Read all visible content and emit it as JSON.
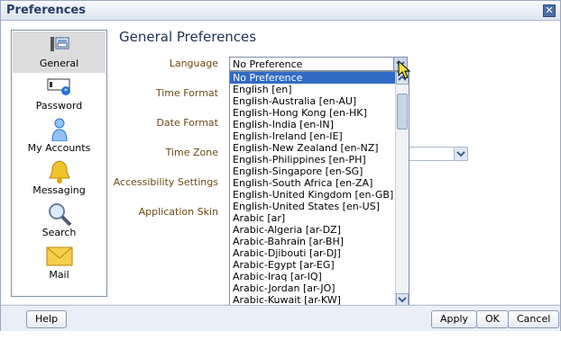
{
  "window": {
    "title": "Preferences"
  },
  "sidebar": {
    "items": [
      {
        "label": "General",
        "icon": "general-icon",
        "selected": true
      },
      {
        "label": "Password",
        "icon": "password-icon"
      },
      {
        "label": "My Accounts",
        "icon": "accounts-icon"
      },
      {
        "label": "Messaging",
        "icon": "bell-icon"
      },
      {
        "label": "Search",
        "icon": "magnifier-icon"
      },
      {
        "label": "Mail",
        "icon": "envelope-icon"
      }
    ]
  },
  "main": {
    "heading": "General Preferences",
    "fields": {
      "language": "Language",
      "time_format": "Time Format",
      "date_format": "Date Format",
      "time_zone": "Time Zone",
      "accessibility": "Accessibility Settings",
      "skin": "Application Skin"
    },
    "language_select": {
      "value": "No Preference",
      "options": [
        "No Preference",
        "English [en]",
        "English-Australia [en-AU]",
        "English-Hong Kong [en-HK]",
        "English-India [en-IN]",
        "English-Ireland [en-IE]",
        "English-New Zealand [en-NZ]",
        "English-Philippines [en-PH]",
        "English-Singapore [en-SG]",
        "English-South Africa [en-ZA]",
        "English-United Kingdom [en-GB]",
        "English-United States [en-US]",
        "Arabic [ar]",
        "Arabic-Algeria [ar-DZ]",
        "Arabic-Bahrain [ar-BH]",
        "Arabic-Djibouti [ar-DJ]",
        "Arabic-Egypt [ar-EG]",
        "Arabic-Iraq [ar-IQ]",
        "Arabic-Jordan [ar-JO]",
        "Arabic-Kuwait [ar-KW]"
      ]
    }
  },
  "footer": {
    "help": "Help",
    "apply": "Apply",
    "ok": "OK",
    "cancel": "Cancel"
  },
  "colors": {
    "accent": "#316ac5",
    "label": "#6a4a12",
    "heading": "#1f3150"
  }
}
